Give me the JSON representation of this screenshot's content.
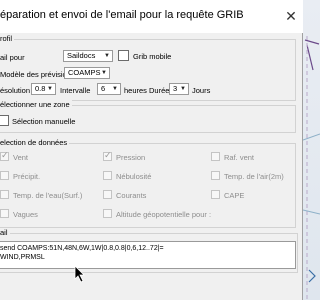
{
  "dialog": {
    "title": "éparation et envoi de l'email pour la requête GRIB",
    "close_glyph": "✕"
  },
  "profil": {
    "group_label": "rofil",
    "mail_label": "ail pour",
    "mail_value": "Saildocs",
    "grib_mobile_label": "Grib mobile",
    "model_label": "Modèle des prévisions",
    "model_value": "COAMPS",
    "resolution_label": "ésolution",
    "resolution_value": "0.8",
    "interval_label": "Intervalle",
    "interval_value": "6",
    "interval_unit": "heures",
    "duration_label": "Durée",
    "duration_value": "3",
    "duration_unit": "Jours"
  },
  "zone": {
    "group_label": "électionner une zone",
    "manual_label": "Sélection manuelle"
  },
  "data_selection": {
    "group_label": "election de données",
    "items": {
      "vent": {
        "label": "Vent",
        "checked": true
      },
      "pression": {
        "label": "Pression",
        "checked": true
      },
      "raf_vent": {
        "label": "Raf. vent",
        "checked": false
      },
      "precip": {
        "label": "Précipit.",
        "checked": false
      },
      "nebulosite": {
        "label": "Nébulosité",
        "checked": false
      },
      "temp_air": {
        "label": "Temp. de l'air(2m)",
        "checked": false
      },
      "temp_eau": {
        "label": "Temp. de l'eau(Surf.)",
        "checked": false
      },
      "courants": {
        "label": "Courants",
        "checked": false
      },
      "cape": {
        "label": "CAPE",
        "checked": false
      },
      "vagues": {
        "label": "Vagues",
        "checked": false
      },
      "altitude": {
        "label": "Altitude géopotentielle pour :",
        "checked": false
      }
    }
  },
  "mail": {
    "group_label": "ail",
    "content": "send COAMPS:51N,48N,6W,1W|0.8,0.8|0,6,12..72|=\nWIND,PRMSL"
  },
  "icons": {
    "arrow": "▼",
    "check": "✓"
  },
  "colors": {
    "dialog_bg": "#f0f0f0",
    "map_line": "#6b4a8a"
  }
}
